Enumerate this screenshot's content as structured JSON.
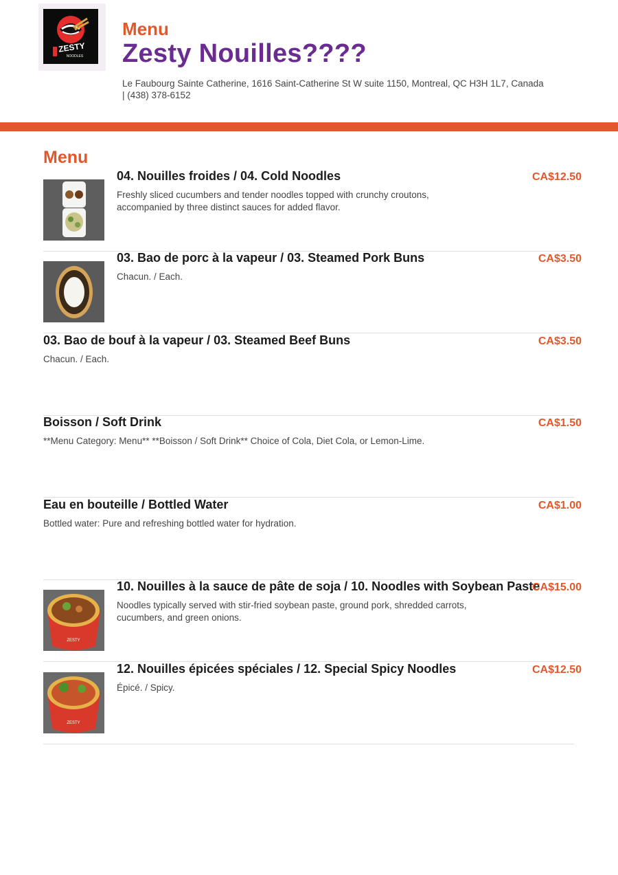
{
  "header": {
    "kicker": "Menu",
    "restaurant_name": "Zesty Nouilles????",
    "address": "Le Faubourg Sainte Catherine, 1616 Saint-Catherine St W suite 1150, Montreal, QC H3H 1L7, Canada | (438) 378-6152",
    "logo_icon": "zesty-logo-icon",
    "logo_text": "ZESTY NOODLES"
  },
  "colors": {
    "accent": "#e3582a",
    "brand": "#6a2c91",
    "divider": "#e0e0e0"
  },
  "section": {
    "title": "Menu"
  },
  "items": [
    {
      "name": "04. Nouilles froides / 04. Cold Noodles",
      "description": "Freshly sliced cucumbers and tender noodles topped with crunchy croutons, accompanied by three distinct sauces for added flavor.",
      "price": "CA$12.50",
      "image": "cold-noodles-photo"
    },
    {
      "name": "03. Bao de porc à la vapeur / 03. Steamed Pork Buns",
      "description": "Chacun. / Each.",
      "price": "CA$3.50",
      "image": "steamed-bun-photo"
    },
    {
      "name": "03. Bao de bouf à la vapeur / 03. Steamed Beef Buns",
      "description": "Chacun. / Each.",
      "price": "CA$3.50"
    },
    {
      "name": "Boisson / Soft Drink",
      "description": "**Menu Category: Menu** **Boisson / Soft Drink** Choice of Cola, Diet Cola, or Lemon-Lime.",
      "price": "CA$1.50"
    },
    {
      "name": "Eau en bouteille / Bottled Water",
      "description": "Bottled water: Pure and refreshing bottled water for hydration.",
      "price": "CA$1.00"
    },
    {
      "name": "10. Nouilles à la sauce de pâte de soja / 10. Noodles with Soybean Paste",
      "description": "Noodles typically served with stir-fried soybean paste, ground pork, shredded carrots, cucumbers, and green onions.",
      "price": "CA$15.00",
      "image": "soybean-noodles-bowl-photo"
    },
    {
      "name": "12. Nouilles épicées spéciales / 12. Special Spicy Noodles",
      "description": "Épicé. / Spicy.",
      "price": "CA$12.50",
      "image": "spicy-noodles-bowl-photo"
    }
  ]
}
